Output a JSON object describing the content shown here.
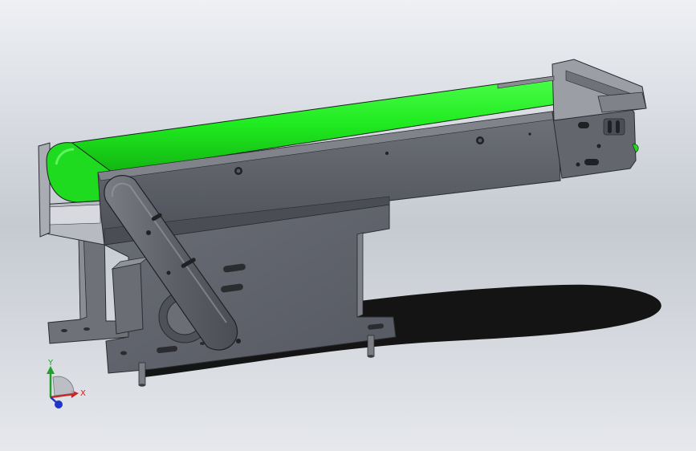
{
  "scene": {
    "subject": "conveyor-model",
    "belt_color": "#22ee22",
    "frame_color": "#5b5e66",
    "background_top": "#eef0f4",
    "background_bottom": "#c5cad1"
  },
  "triad": {
    "x_label": "X",
    "y_label": "Y",
    "x_color": "#d22020",
    "y_color": "#1fa02a",
    "z_color": "#1f36c8"
  }
}
